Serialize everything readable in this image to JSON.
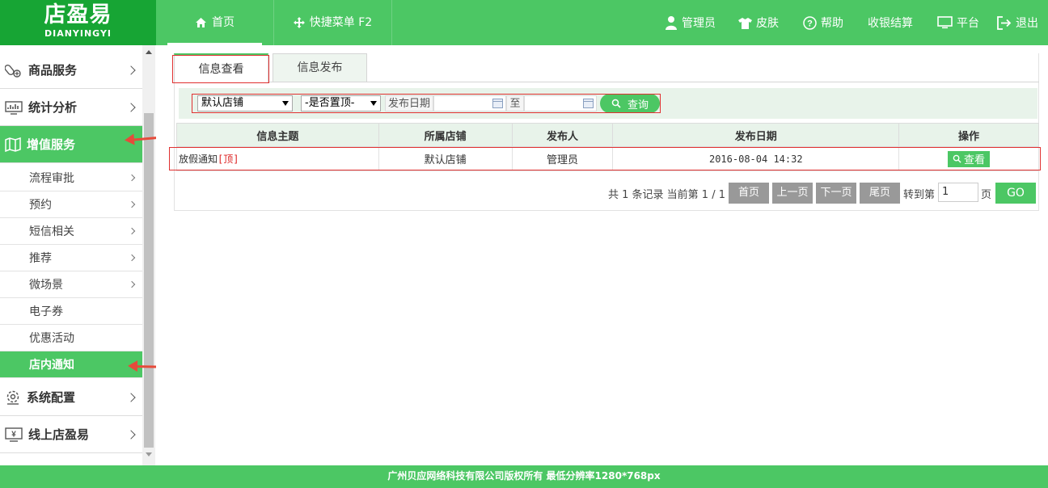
{
  "app": {
    "logo_cn": "店盈易",
    "logo_en": "DIANYINGYI"
  },
  "header": {
    "nav": [
      {
        "label": "首页",
        "icon": "home-icon"
      },
      {
        "label": "快捷菜单 F2",
        "icon": "move-icon"
      }
    ],
    "right": [
      {
        "label": "管理员",
        "icon": "user-icon"
      },
      {
        "label": "皮肤",
        "icon": "shirt-icon"
      },
      {
        "label": "帮助",
        "icon": "help-icon"
      },
      {
        "label": "收银结算",
        "icon": ""
      },
      {
        "label": "平台",
        "icon": "monitor-icon"
      },
      {
        "label": "退出",
        "icon": "logout-icon"
      }
    ]
  },
  "sidebar": {
    "categories": [
      {
        "label": "商品服务",
        "icon": "goods-icon"
      },
      {
        "label": "统计分析",
        "icon": "chart-icon"
      },
      {
        "label": "增值服务",
        "icon": "map-icon"
      },
      {
        "label": "系统配置",
        "icon": "settings-icon"
      },
      {
        "label": "线上店盈易",
        "icon": "yen-monitor-icon"
      }
    ],
    "subitems": [
      "流程审批",
      "预约",
      "短信相关",
      "推荐",
      "微场景",
      "电子券",
      "优惠活动",
      "店内通知"
    ]
  },
  "tabs": [
    "信息查看",
    "信息发布"
  ],
  "filter": {
    "store_value": "默认店铺",
    "top_value": "-是否置顶-",
    "date_label": "发布日期",
    "to_label": "至",
    "date_from": "",
    "date_to": "",
    "query_label": "查询"
  },
  "table": {
    "headers": [
      "信息主题",
      "所属店铺",
      "发布人",
      "发布日期",
      "操作"
    ],
    "rows": [
      {
        "title": "放假通知",
        "tag": "[顶]",
        "store": "默认店铺",
        "publisher": "管理员",
        "date": "2016-08-04 14:32",
        "action": "查看"
      }
    ]
  },
  "pager": {
    "summary": "共 1 条记录 当前第 1 / 1",
    "first": "首页",
    "prev": "上一页",
    "next": "下一页",
    "last": "尾页",
    "goto_label": "转到第",
    "page_value": "1",
    "page_unit": "页",
    "go": "GO"
  },
  "footer": {
    "text": "广州贝应网络科技有限公司版权所有 最低分辨率1280*768px"
  },
  "colors": {
    "brand_green": "#4cc764",
    "logo_green": "#17a534",
    "highlight_red": "#e03030"
  }
}
